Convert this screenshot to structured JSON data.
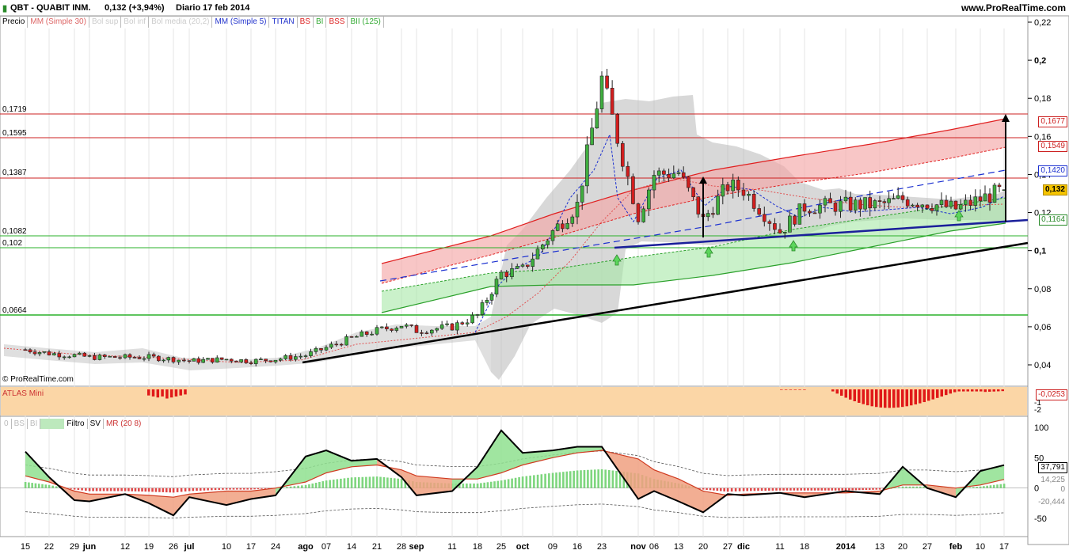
{
  "header": {
    "symbol": "QBT - QUABIT INM.",
    "quote": "0,132 (+3,94%)",
    "period": "Diario",
    "date": "17 feb 2014",
    "site": "www.ProRealTime.com"
  },
  "legend": {
    "items": [
      "Precio",
      "MM (Simple 30)",
      "Bol sup",
      "Bol inf",
      "Bol media (20,2)",
      "MM (Simple 5)",
      "TITAN",
      "BS",
      "BI",
      "BSS",
      "BII (125)"
    ]
  },
  "levels": {
    "l1719": "0,1719",
    "l1595": "0,1595",
    "l1387": "0,1387",
    "l1082": "0,1082",
    "l102": "0,102",
    "l0664": "0,0664"
  },
  "price_axis": [
    "0,22",
    "0,2",
    "0,18",
    "0,16",
    "0,14",
    "0,12",
    "0,1",
    "0,08",
    "0,06",
    "0,04"
  ],
  "price_tags": {
    "upper": "0,1677",
    "mid": "0,1549",
    "blue": "0,1420",
    "last": "0,132",
    "green": "0,1164"
  },
  "watermark": "© ProRealTime.com",
  "atlas": {
    "title": "ATLAS Mini",
    "value": "-0,0253",
    "axis": [
      "-1",
      "-2"
    ]
  },
  "osc": {
    "legend": [
      "0",
      "BS",
      "BI",
      "Filtro",
      "SV",
      "MR (20 8)"
    ],
    "axis": [
      "100",
      "50",
      "0",
      "-50"
    ],
    "tags": [
      "37,791",
      "14,225",
      "0",
      "-20,444"
    ]
  },
  "x_axis": [
    "15",
    "22",
    "29",
    "jun",
    "12",
    "19",
    "26",
    "jul",
    "10",
    "17",
    "24",
    "ago",
    "07",
    "14",
    "21",
    "28",
    "sep",
    "11",
    "18",
    "25",
    "oct",
    "09",
    "16",
    "23",
    "nov",
    "06",
    "13",
    "20",
    "27",
    "dic",
    "11",
    "18",
    "2014",
    "13",
    "20",
    "27",
    "feb",
    "10",
    "17"
  ],
  "colors": {
    "up": "#3fae3f",
    "down": "#d21e1e",
    "red_band": "#e84a4a",
    "green_band": "#4ccc4c",
    "grey_band": "#b0b0b0",
    "blue": "#1a2fd0"
  },
  "chart_data": [
    {
      "type": "candlestick",
      "title": "QBT - QUABIT INM.",
      "ylim": [
        0.03,
        0.22
      ],
      "x": [
        "15 may",
        "22 may",
        "29 may",
        "jun",
        "12 jun",
        "19 jun",
        "26 jun",
        "jul",
        "10 jul",
        "17 jul",
        "24 jul",
        "ago",
        "07 ago",
        "14 ago",
        "21 ago",
        "28 ago",
        "sep",
        "11 sep",
        "18 sep",
        "25 sep",
        "oct",
        "09 oct",
        "16 oct",
        "23 oct",
        "nov",
        "06 nov",
        "13 nov",
        "20 nov",
        "27 nov",
        "dic",
        "11 dic",
        "18 dic",
        "2014",
        "13 ene",
        "20 ene",
        "27 ene",
        "feb",
        "10 feb",
        "17 feb"
      ],
      "close": [
        0.048,
        0.046,
        0.045,
        0.044,
        0.044,
        0.044,
        0.043,
        0.042,
        0.043,
        0.042,
        0.043,
        0.045,
        0.049,
        0.054,
        0.058,
        0.061,
        0.058,
        0.06,
        0.066,
        0.088,
        0.09,
        0.11,
        0.124,
        0.19,
        0.118,
        0.14,
        0.141,
        0.116,
        0.134,
        0.132,
        0.11,
        0.123,
        0.124,
        0.124,
        0.127,
        0.125,
        0.122,
        0.127,
        0.132
      ],
      "horizontal_levels": [
        0.1719,
        0.1595,
        0.1387,
        0.1082,
        0.102,
        0.0664
      ]
    },
    {
      "type": "bar",
      "title": "ATLAS Mini",
      "ylim": [
        -2.5,
        0
      ],
      "last": -0.0253
    },
    {
      "type": "area",
      "title": "MR (20 8)",
      "ylim": [
        -70,
        110
      ],
      "x": [
        "15 may",
        "22 may",
        "29 may",
        "jun",
        "12 jun",
        "19 jun",
        "26 jun",
        "jul",
        "10 jul",
        "17 jul",
        "24 jul",
        "ago",
        "07 ago",
        "14 ago",
        "21 ago",
        "28 ago",
        "sep",
        "11 sep",
        "18 sep",
        "25 sep",
        "oct",
        "09 oct",
        "16 oct",
        "23 oct",
        "nov",
        "06 nov",
        "13 nov",
        "20 nov",
        "27 nov",
        "dic",
        "11 dic",
        "18 dic",
        "2014",
        "13 ene",
        "20 ene",
        "27 ene",
        "feb",
        "10 feb",
        "17 feb"
      ],
      "values": [
        60,
        18,
        -20,
        -22,
        -10,
        -25,
        -45,
        -15,
        -28,
        -18,
        -12,
        52,
        62,
        45,
        48,
        18,
        -12,
        -5,
        35,
        95,
        58,
        62,
        68,
        68,
        -18,
        -5,
        -22,
        -40,
        -10,
        -12,
        -8,
        -15,
        -5,
        -10,
        35,
        0,
        -15,
        28,
        37.791
      ],
      "signal": [
        20,
        10,
        -5,
        -10,
        -10,
        -12,
        -15,
        -10,
        -5,
        -5,
        0,
        10,
        25,
        35,
        38,
        30,
        20,
        15,
        15,
        25,
        38,
        50,
        58,
        62,
        48,
        30,
        15,
        -5,
        -12,
        -10,
        -8,
        -8,
        -8,
        -5,
        5,
        5,
        0,
        5,
        14.225
      ]
    }
  ]
}
